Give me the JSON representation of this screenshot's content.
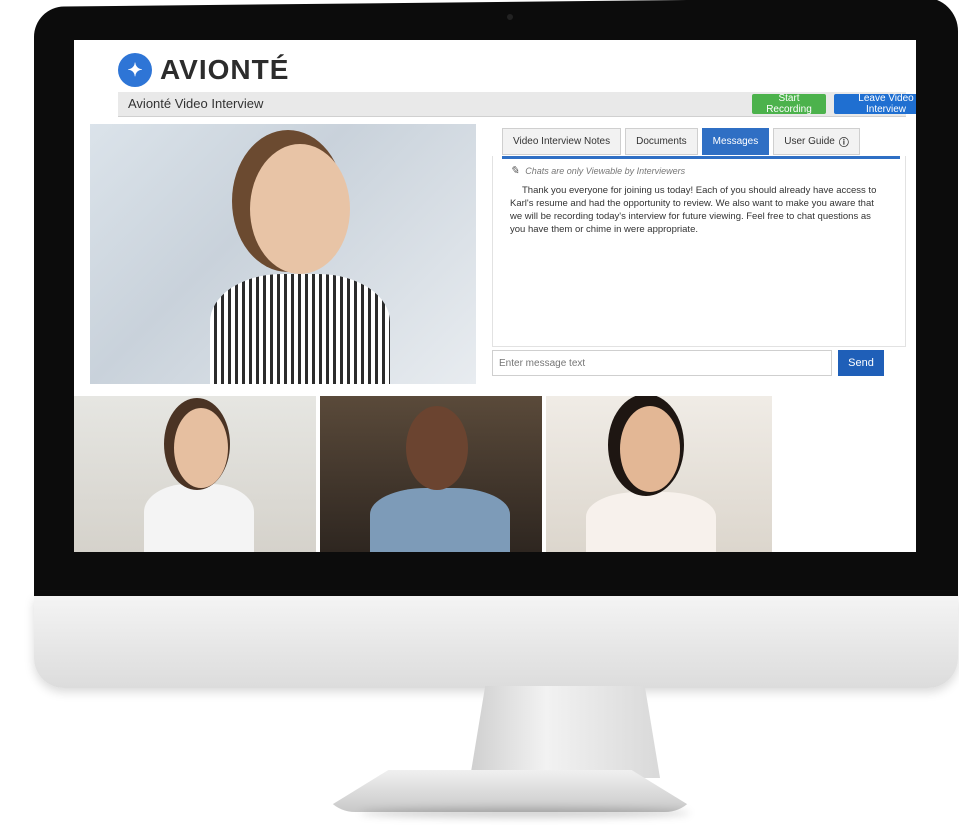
{
  "app": {
    "brand": "AVIONTÉ",
    "title": "Avionté Video Interview"
  },
  "header": {
    "start_recording": "Start Recording",
    "leave_interview": "Leave Video Interview"
  },
  "tabs": [
    {
      "label": "Video Interview Notes",
      "active": false
    },
    {
      "label": "Documents",
      "active": false
    },
    {
      "label": "Messages",
      "active": true
    },
    {
      "label": "User Guide",
      "active": false
    }
  ],
  "messages": {
    "notice": "Chats are only Viewable by Interviewers",
    "body": "Thank you everyone for joining us today! Each of you should already have access to Karl's resume and had the opportunity to review. We also want to make you aware that we will be recording today's interview for future viewing. Feel free to chat questions as you have them or chime in were appropriate.",
    "input_placeholder": "Enter message text",
    "send_label": "Send"
  },
  "colors": {
    "accent": "#2f6fc4",
    "record": "#4cb24c",
    "leave": "#1f6fd1"
  },
  "icons": {
    "info": "ⓘ",
    "pencil": "✎"
  }
}
